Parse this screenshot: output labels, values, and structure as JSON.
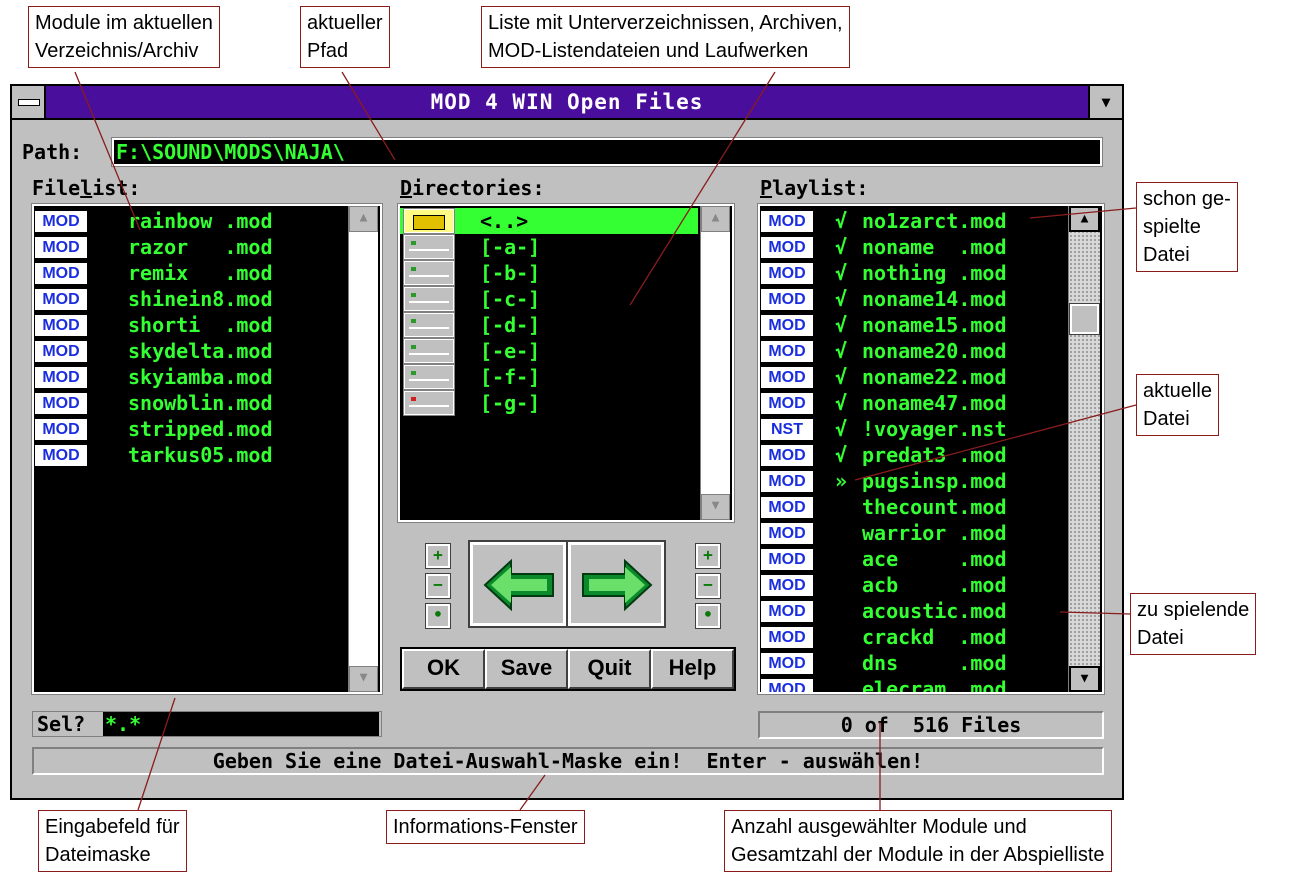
{
  "annotations": {
    "module_list": [
      "Module im aktuellen",
      "Verzeichnis/Archiv"
    ],
    "current_path": [
      "aktueller",
      "Pfad"
    ],
    "dir_list": [
      "Liste mit Unterverzeichnissen, Archiven,",
      "MOD-Listendateien und Laufwerken"
    ],
    "played": [
      "schon ge-",
      "spielte",
      "Datei"
    ],
    "current_file": [
      "aktuelle",
      "Datei"
    ],
    "to_play": [
      "zu spielende",
      "Datei"
    ],
    "mask_field": [
      "Eingabefeld für",
      "Dateimaske"
    ],
    "info_window": [
      "Informations-Fenster"
    ],
    "count": [
      "Anzahl ausgewählter Module und",
      "Gesamtzahl der Module in der Abspielliste"
    ]
  },
  "window": {
    "title": "MOD 4 WIN Open Files",
    "path_label": "Path:",
    "path_value": "F:\\SOUND\\MODS\\NAJA\\",
    "filelist_label_pre": "File",
    "filelist_label_ul": "l",
    "filelist_label_post": "ist:",
    "directories_label_ul": "D",
    "directories_label_rest": "irectories:",
    "playlist_label_ul": "P",
    "playlist_label_rest": "laylist:"
  },
  "filelist": [
    {
      "tag": "MOD",
      "name": "rainbow .mod"
    },
    {
      "tag": "MOD",
      "name": "razor   .mod"
    },
    {
      "tag": "MOD",
      "name": "remix   .mod"
    },
    {
      "tag": "MOD",
      "name": "shinein8.mod"
    },
    {
      "tag": "MOD",
      "name": "shorti  .mod"
    },
    {
      "tag": "MOD",
      "name": "skydelta.mod"
    },
    {
      "tag": "MOD",
      "name": "skyiamba.mod"
    },
    {
      "tag": "MOD",
      "name": "snowblin.mod"
    },
    {
      "tag": "MOD",
      "name": "stripped.mod"
    },
    {
      "tag": "MOD",
      "name": "tarkus05.mod"
    }
  ],
  "directories": [
    {
      "name": "<..>",
      "icon": "parent-folder-icon",
      "selected": true
    },
    {
      "name": "[-a-]",
      "icon": "floppy-drive-icon"
    },
    {
      "name": "[-b-]",
      "icon": "floppy-drive-icon"
    },
    {
      "name": "[-c-]",
      "icon": "hard-drive-icon"
    },
    {
      "name": "[-d-]",
      "icon": "hard-drive-icon"
    },
    {
      "name": "[-e-]",
      "icon": "hard-drive-icon"
    },
    {
      "name": "[-f-]",
      "icon": "hard-drive-icon"
    },
    {
      "name": "[-g-]",
      "icon": "network-drive-icon"
    }
  ],
  "playlist": [
    {
      "tag": "MOD",
      "mark": "√",
      "name": "no1zarct.mod"
    },
    {
      "tag": "MOD",
      "mark": "√",
      "name": "noname  .mod"
    },
    {
      "tag": "MOD",
      "mark": "√",
      "name": "nothing .mod"
    },
    {
      "tag": "MOD",
      "mark": "√",
      "name": "noname14.mod"
    },
    {
      "tag": "MOD",
      "mark": "√",
      "name": "noname15.mod"
    },
    {
      "tag": "MOD",
      "mark": "√",
      "name": "noname20.mod"
    },
    {
      "tag": "MOD",
      "mark": "√",
      "name": "noname22.mod"
    },
    {
      "tag": "MOD",
      "mark": "√",
      "name": "noname47.mod"
    },
    {
      "tag": "NST",
      "mark": "√",
      "name": "!voyager.nst"
    },
    {
      "tag": "MOD",
      "mark": "√",
      "name": "predat3 .mod"
    },
    {
      "tag": "MOD",
      "mark": "»",
      "name": "pugsinsp.mod"
    },
    {
      "tag": "MOD",
      "mark": "",
      "name": "thecount.mod"
    },
    {
      "tag": "MOD",
      "mark": "",
      "name": "warrior .mod"
    },
    {
      "tag": "MOD",
      "mark": "",
      "name": "ace     .mod"
    },
    {
      "tag": "MOD",
      "mark": "",
      "name": "acb     .mod"
    },
    {
      "tag": "MOD",
      "mark": "",
      "name": "acoustic.mod"
    },
    {
      "tag": "MOD",
      "mark": "",
      "name": "crackd  .mod"
    },
    {
      "tag": "MOD",
      "mark": "",
      "name": "dns     .mod"
    },
    {
      "tag": "MOD",
      "mark": "",
      "name": "elecram .mod"
    }
  ],
  "buttons": {
    "ok": "OK",
    "save": "Save",
    "quit": "Quit",
    "help": "Help",
    "plus": "+",
    "minus": "−",
    "dot": "•"
  },
  "selection": {
    "label": "Sel?",
    "mask": "*.*"
  },
  "count_text": "0 of  516 Files",
  "info_text": "Geben Sie eine Datei-Auswahl-Maske ein!  Enter - auswählen!",
  "colors": {
    "title_bar": "#4a0e9c",
    "list_text": "#33ff33",
    "tag_text": "#1a2ee0",
    "callout_border": "#8a1c1c"
  }
}
